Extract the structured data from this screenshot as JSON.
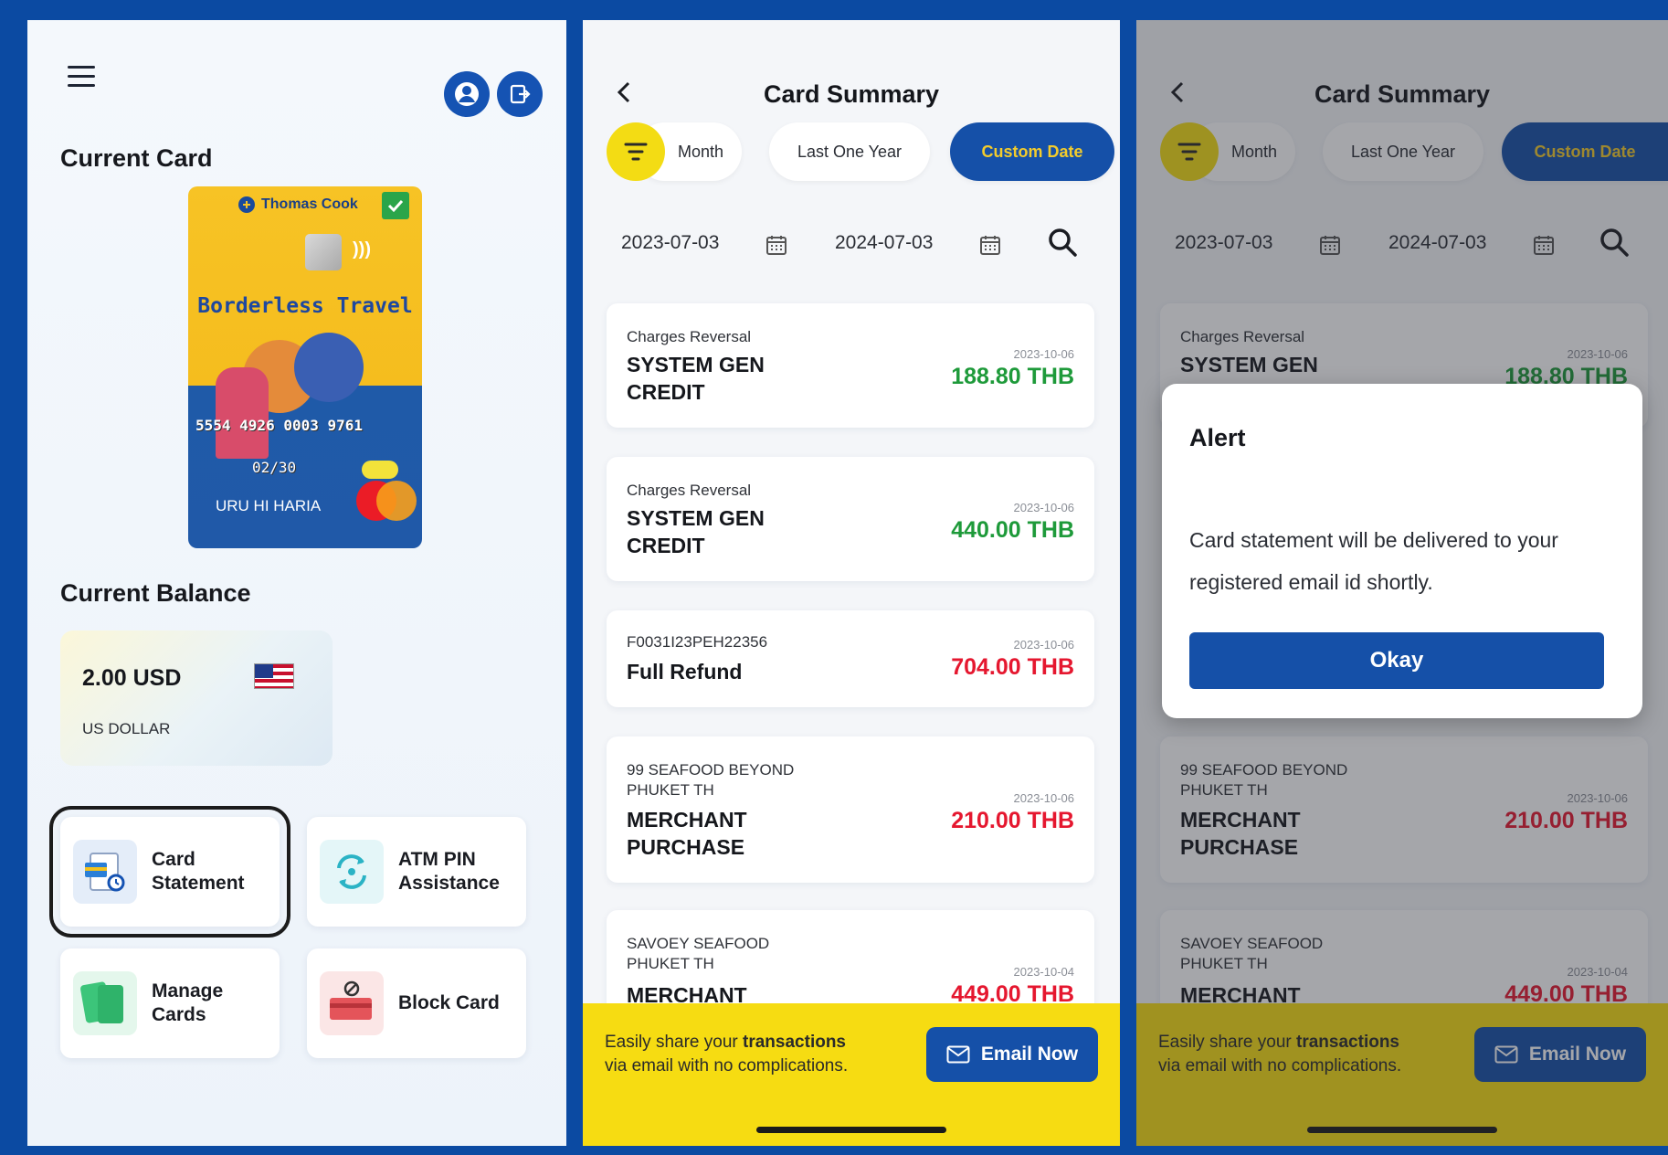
{
  "home": {
    "current_card_label": "Current Card",
    "card": {
      "brand": "Thomas Cook",
      "product": "Borderless Travel",
      "number": "5554 4926 0003 9761",
      "expiry": "02/30",
      "holder": "URU HI HARIA"
    },
    "current_balance_label": "Current Balance",
    "balance": {
      "amount": "2.00 USD",
      "currency_name": "US DOLLAR",
      "flag_icon": "us-flag-icon"
    },
    "tiles": [
      {
        "label": "Card\nStatement",
        "icon": "card-statement-icon"
      },
      {
        "label": "ATM PIN\nAssistance",
        "icon": "atm-pin-icon"
      },
      {
        "label": "Manage\nCards",
        "icon": "manage-cards-icon"
      },
      {
        "label": "Block Card",
        "icon": "block-card-icon"
      }
    ]
  },
  "summary": {
    "title": "Card Summary",
    "filters": {
      "month": "Month",
      "last_one_year": "Last One Year",
      "custom_date": "Custom Date"
    },
    "from_date": "2023-07-03",
    "to_date": "2024-07-03",
    "transactions": [
      {
        "category": "Charges Reversal",
        "description": "SYSTEM GEN\nCREDIT",
        "date": "2023-10-06",
        "amount": "188.80 THB",
        "type": "credit"
      },
      {
        "category": "Charges Reversal",
        "description": "SYSTEM GEN\nCREDIT",
        "date": "2023-10-06",
        "amount": "440.00 THB",
        "type": "credit"
      },
      {
        "category": "F0031I23PEH22356",
        "description": "Full Refund",
        "date": "2023-10-06",
        "amount": "704.00 THB",
        "type": "debit"
      },
      {
        "category": "99 SEAFOOD BEYOND\nPHUKET      TH",
        "description": "MERCHANT\nPURCHASE",
        "date": "2023-10-06",
        "amount": "210.00 THB",
        "type": "debit"
      },
      {
        "category": "SAVOEY SEAFOOD\nPHUKET      TH",
        "description": "MERCHANT",
        "date": "2023-10-04",
        "amount": "449.00 THB",
        "type": "debit"
      }
    ],
    "share_text_1": "Easily share your ",
    "share_text_bold": "transactions",
    "share_text_2": "via email with no complications.",
    "email_button": "Email Now"
  },
  "alert": {
    "title": "Alert",
    "message": "Card statement will be delivered to your registered email id shortly.",
    "button": "Okay"
  },
  "colors": {
    "brand_blue": "#1550a8",
    "accent_yellow": "#f6dc12",
    "credit_green": "#1e9a3a",
    "debit_red": "#e5172f"
  }
}
